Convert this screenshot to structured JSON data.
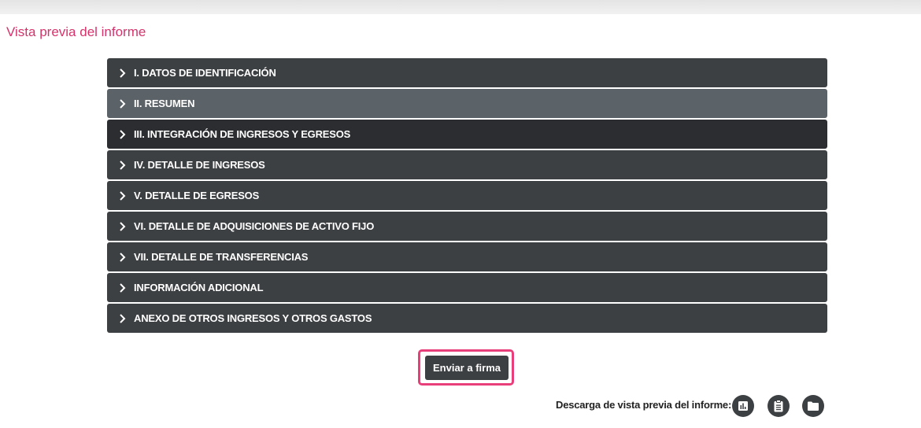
{
  "page": {
    "title": "Vista previa del informe"
  },
  "accordion": {
    "items": [
      {
        "label": "I. DATOS DE IDENTIFICACIÓN"
      },
      {
        "label": "II. RESUMEN"
      },
      {
        "label": "III. INTEGRACIÓN DE INGRESOS Y EGRESOS"
      },
      {
        "label": "IV. DETALLE DE INGRESOS"
      },
      {
        "label": "V. DETALLE DE EGRESOS"
      },
      {
        "label": "VI. DETALLE DE ADQUISICIONES DE ACTIVO FIJO"
      },
      {
        "label": "VII. DETALLE DE TRANSFERENCIAS"
      },
      {
        "label": "INFORMACIÓN ADICIONAL"
      },
      {
        "label": "ANEXO DE OTROS INGRESOS Y OTROS GASTOS"
      }
    ]
  },
  "actions": {
    "send_label": "Enviar a firma"
  },
  "download": {
    "label": "Descarga de vista previa del informe:",
    "icons": [
      "chart-icon",
      "clipboard-icon",
      "folder-icon"
    ]
  },
  "colors": {
    "title": "#d6336c",
    "accordion_bg": "#3d4043",
    "accordion_hover": "#5b6268",
    "highlight": "#e83e7a"
  }
}
